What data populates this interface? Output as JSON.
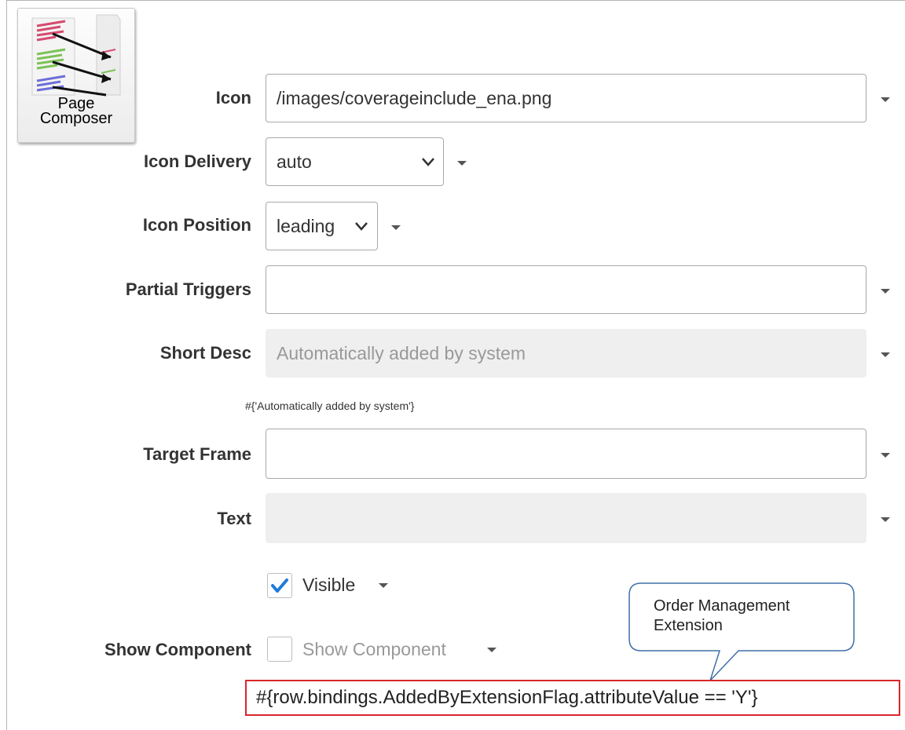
{
  "page_composer": {
    "label": "Page\nComposer",
    "icon": "page-composer-icon"
  },
  "form": {
    "icon": {
      "label": "Icon",
      "value": "/images/coverageinclude_ena.png"
    },
    "icon_delivery": {
      "label": "Icon Delivery",
      "value": "auto"
    },
    "icon_position": {
      "label": "Icon Position",
      "value": "leading"
    },
    "partial_triggers": {
      "label": "Partial Triggers",
      "value": ""
    },
    "short_desc": {
      "label": "Short Desc",
      "value": "Automatically added by system",
      "expression": "#{'Automatically added by system'}"
    },
    "target_frame": {
      "label": "Target Frame",
      "value": ""
    },
    "text": {
      "label": "Text",
      "value": ""
    },
    "visible": {
      "label": "Visible",
      "checked": true
    },
    "show_component": {
      "label": "Show Component",
      "checkbox_label": "Show Component",
      "checked": false,
      "expression": "#{row.bindings.AddedByExtensionFlag.attributeValue == 'Y'}"
    }
  },
  "callout": {
    "text": "Order Management\nExtension"
  },
  "colors": {
    "highlight_border": "#d9262c",
    "check_blue": "#1f7ad8",
    "readonly_bg": "#efefef"
  }
}
